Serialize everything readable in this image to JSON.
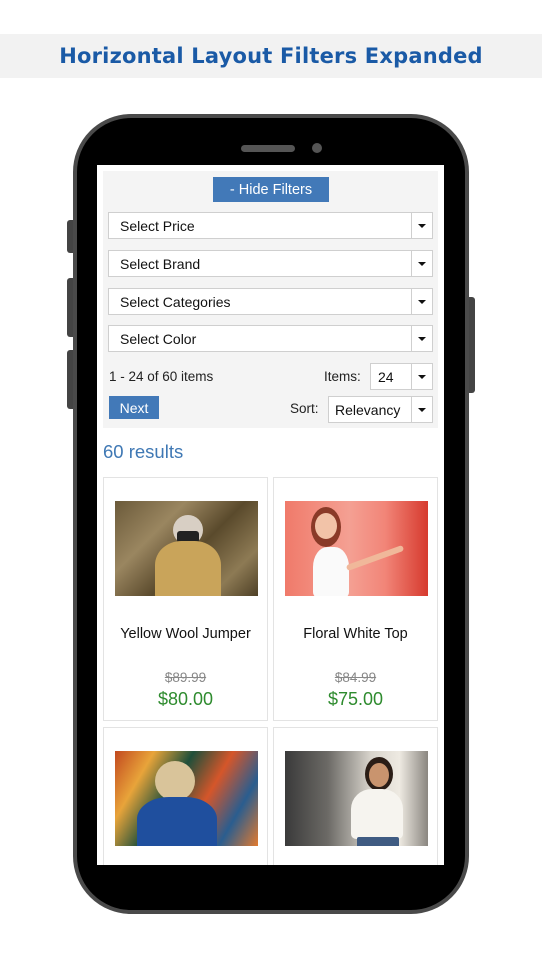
{
  "banner": {
    "title": "Horizontal Layout Filters Expanded"
  },
  "filters": {
    "toggle_label": "- Hide Filters",
    "selects": [
      {
        "label": "Select Price"
      },
      {
        "label": "Select Brand"
      },
      {
        "label": "Select Categories"
      },
      {
        "label": "Select Color"
      }
    ],
    "range_text": "1 - 24 of 60 items",
    "items_label": "Items:",
    "items_value": "24",
    "next_label": "Next",
    "sort_label": "Sort:",
    "sort_value": "Relevancy"
  },
  "results": {
    "count_text": "60 results",
    "products": [
      {
        "name": "Yellow Wool Jumper",
        "old_price": "$89.99",
        "price": "$80.00",
        "image": "woman-with-camera-in-cornfield"
      },
      {
        "name": "Floral White Top",
        "old_price": "$84.99",
        "price": "$75.00",
        "image": "woman-in-white-top-red-wall"
      },
      {
        "name": "",
        "old_price": "",
        "price": "",
        "image": "woman-at-carnival-lights"
      },
      {
        "name": "",
        "old_price": "",
        "price": "",
        "image": "woman-in-white-shirt-street"
      }
    ]
  },
  "colors": {
    "accent": "#4279b8",
    "title": "#1a5aa6",
    "price": "#2e8b2e",
    "results_count": "#3f78b4"
  }
}
